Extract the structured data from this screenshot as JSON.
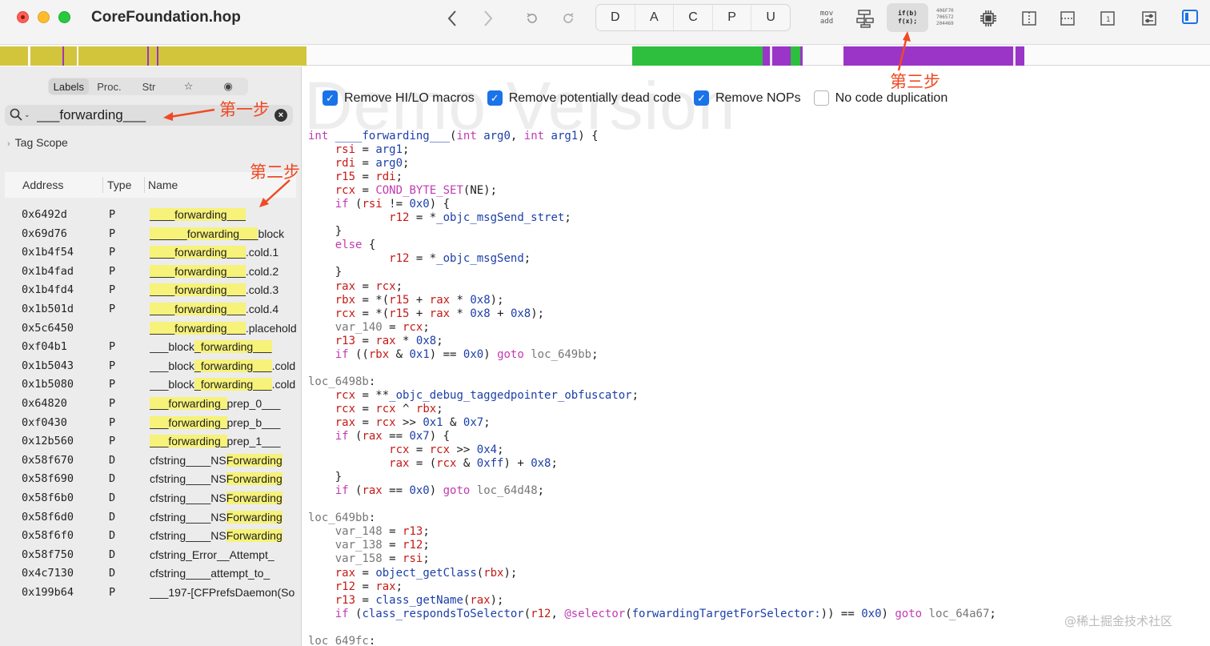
{
  "window": {
    "title": "CoreFoundation.hop"
  },
  "toolbar": {
    "segments": [
      "D",
      "A",
      "C",
      "P",
      "U"
    ],
    "mov_label": "mov",
    "add_label": "add",
    "pseudo_line1": "if(b)",
    "pseudo_line2": "f(x);",
    "hex_lines": [
      "406F70",
      "706572",
      "204469"
    ],
    "page_label": "1"
  },
  "sidebar": {
    "tabs": [
      "Labels",
      "Proc.",
      "Str",
      "☆",
      "◉"
    ],
    "search": {
      "value": "___forwarding___",
      "placeholder": ""
    },
    "tag_scope": "Tag Scope",
    "columns": {
      "address": "Address",
      "type": "Type",
      "name": "Name"
    },
    "rows": [
      {
        "address": "0x6492d",
        "type": "P",
        "name": "____forwarding___"
      },
      {
        "address": "0x69d76",
        "type": "P",
        "name": "______forwarding___block"
      },
      {
        "address": "0x1b4f54",
        "type": "P",
        "name": "____forwarding___.cold.1"
      },
      {
        "address": "0x1b4fad",
        "type": "P",
        "name": "____forwarding___.cold.2"
      },
      {
        "address": "0x1b4fd4",
        "type": "P",
        "name": "____forwarding___.cold.3"
      },
      {
        "address": "0x1b501d",
        "type": "P",
        "name": "____forwarding___.cold.4"
      },
      {
        "address": "0x5c6450",
        "type": "",
        "name": "____forwarding___.placeholder"
      },
      {
        "address": "0xf04b1",
        "type": "P",
        "name": "___block_forwarding___"
      },
      {
        "address": "0x1b5043",
        "type": "P",
        "name": "___block_forwarding___.cold"
      },
      {
        "address": "0x1b5080",
        "type": "P",
        "name": "___block_forwarding___.cold"
      },
      {
        "address": "0x64820",
        "type": "P",
        "name": "___forwarding_prep_0___"
      },
      {
        "address": "0xf0430",
        "type": "P",
        "name": "___forwarding_prep_b___"
      },
      {
        "address": "0x12b560",
        "type": "P",
        "name": "___forwarding_prep_1___"
      },
      {
        "address": "0x58f670",
        "type": "D",
        "name": "cfstring____NSForwarding"
      },
      {
        "address": "0x58f690",
        "type": "D",
        "name": "cfstring____NSForwarding"
      },
      {
        "address": "0x58f6b0",
        "type": "D",
        "name": "cfstring____NSForwarding"
      },
      {
        "address": "0x58f6d0",
        "type": "D",
        "name": "cfstring____NSForwarding"
      },
      {
        "address": "0x58f6f0",
        "type": "D",
        "name": "cfstring____NSForwarding"
      },
      {
        "address": "0x58f750",
        "type": "D",
        "name": "cfstring_Error__Attempt_"
      },
      {
        "address": "0x4c7130",
        "type": "D",
        "name": "cfstring____attempt_to_"
      },
      {
        "address": "0x199b64",
        "type": "P",
        "name": "___197-[CFPrefsDaemon(So"
      }
    ]
  },
  "main": {
    "watermark": "Demo Version",
    "options": [
      {
        "label": "Remove HI/LO macros",
        "checked": true
      },
      {
        "label": "Remove potentially dead code",
        "checked": true
      },
      {
        "label": "Remove NOPs",
        "checked": true
      },
      {
        "label": "No code duplication",
        "checked": false
      }
    ]
  },
  "annotations": {
    "step1": "第一步",
    "step2": "第二步",
    "step3": "第三步",
    "credit": "@稀土掘金技术社区"
  },
  "colors": {
    "accent": "#1a73e8",
    "highlight": "#f6f27a",
    "annotation": "#ef4a25",
    "nav_yellow": "#d2c53c",
    "nav_green": "#2ebf3e",
    "nav_purple": "#9b35c8"
  }
}
